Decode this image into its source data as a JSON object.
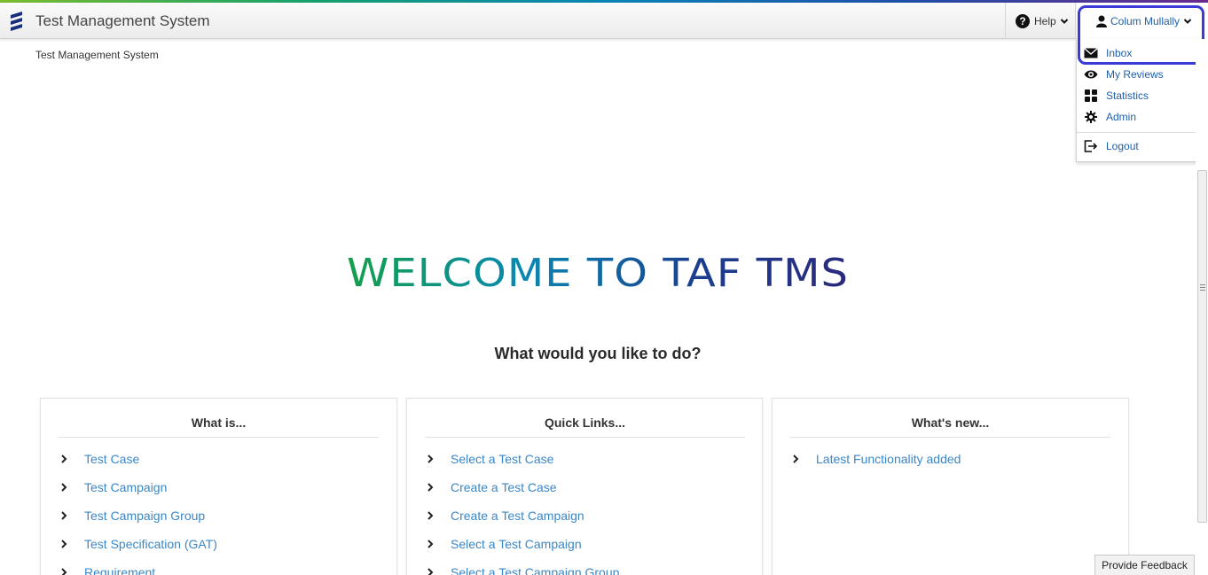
{
  "app": {
    "title": "Test Management System",
    "breadcrumb": "Test Management System"
  },
  "header": {
    "help_label": "Help",
    "user_name": "Colum Mullally"
  },
  "user_menu": {
    "items": [
      {
        "label": "Inbox",
        "icon": "envelope-icon"
      },
      {
        "label": "My Reviews",
        "icon": "eye-icon"
      },
      {
        "label": "Statistics",
        "icon": "grid-icon"
      },
      {
        "label": "Admin",
        "icon": "gear-icon"
      },
      {
        "label": "Logout",
        "icon": "logout-icon"
      }
    ]
  },
  "hero": {
    "title": "WELCOME TO TAF TMS",
    "prompt": "What would you like to do?"
  },
  "cards": [
    {
      "title": "What is...",
      "links": [
        "Test Case",
        "Test Campaign",
        "Test Campaign Group",
        "Test Specification (GAT)",
        "Requirement"
      ]
    },
    {
      "title": "Quick Links...",
      "links": [
        "Select a Test Case",
        "Create a Test Case",
        "Create a Test Campaign",
        "Select a Test Campaign",
        "Select a Test Campaign Group"
      ]
    },
    {
      "title": "What's new...",
      "links": [
        "Latest Functionality added"
      ]
    }
  ],
  "feedback_label": "Provide Feedback",
  "colors": {
    "link": "#3a87c8",
    "menu_link": "#1f5fa8",
    "highlight": "#3a3ad6",
    "welcome_gradient": [
      "#13a04a",
      "#0a88b0",
      "#1b3e8f",
      "#2b2a7c"
    ]
  }
}
